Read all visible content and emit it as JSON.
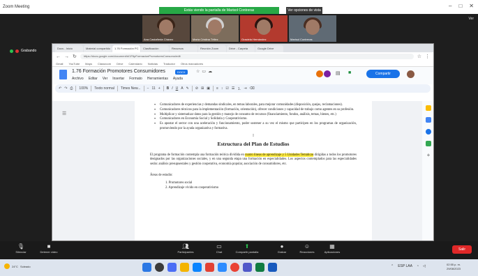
{
  "zoom": {
    "window_title": "Zoom Meeting",
    "share_banner": "Estás viendo la pantalla de Marisol Contreras",
    "view_options": "Ver opciones de vista",
    "view_label": "Ver",
    "participants": [
      {
        "name": "Ana Castañeda Chávez"
      },
      {
        "name": "María Cristina Téllez"
      },
      {
        "name": "Graciela Hernández"
      },
      {
        "name": "Marisol Contreras"
      }
    ],
    "left_indicator": "Grabando"
  },
  "browser": {
    "tabs": [
      "Docs - Inicio",
      "Material compartido",
      "1.76 Formación PC",
      "Clasificación",
      "Recursos",
      "Reunión Zoom",
      "Drive - Carpeta",
      "Google Drive"
    ],
    "url": "https://docs.google.com/document/d/1F6pFormacionPromotoresConsumo/edit",
    "bookmarks": [
      "Gmail",
      "YouTube",
      "Maps",
      "Classroom",
      "Drive",
      "Calendario",
      "Noticias",
      "Traductor",
      "Otros marcadores"
    ]
  },
  "doc": {
    "title": "1.76 Formación Promotores Consumidores",
    "badge": "DOCX",
    "menu": [
      "Archivo",
      "Editar",
      "Ver",
      "Insertar",
      "Formato",
      "Herramientas",
      "Ayuda"
    ],
    "share_label": "Compartir",
    "toolbar": {
      "zoom": "100%",
      "style": "Texto normal",
      "font": "Times New...",
      "size": "11"
    },
    "bullets": [
      "Comunicadores de experiencias y demandas sindicales, en temas laborales, para mejorar comunidades (disposición, quejas, reclamaciones).",
      "Comunicadores técnicos para la implementación (formación, orientación), ofrecer condiciones y capacidad de trabajo como agentes en su profesión.",
      "Multiplicar y sistematizar datos para la gestión y manejo de consumo de recursos (financiamiento, fondos, análisis, temas, bienes, etc.)",
      "Comunicadores en Economía Social y Solidaria y Cooperativismo.",
      "Es apostar el sector con una aceleración y funcionamiento, poder sostener a su vez el mismo que participen en los programas de organización, promoviendo por la ayuda organizativa y formativa."
    ],
    "heading": "Estructura del Plan de Estudios",
    "para_before": "El programa de formación contempla una formación teórica dividida en ",
    "para_highlight": "cuatro líneas de aprendizaje y 5 Unidades Temáticas",
    "para_after": " dirigidas a todos los promotores designados por las organizaciones sociales, y en una segunda etapa una formación en especialidades. Los aspectos contemplados para las especialidades serán: análisis presupuestales y gestión cooperativa, economía popular, asociación de consumidores, etc.",
    "subhead": "Áreas de estudio:",
    "list": [
      "1. Promotores social",
      "2. Aprendizaje vivido en cooperativismo"
    ]
  },
  "controls": {
    "items": [
      "Silenciar",
      "Detener video",
      "Participantes",
      "Chat",
      "Compartir pantalla",
      "Grabar",
      "Reacciones",
      "Aplicaciones"
    ],
    "end": "Salir"
  },
  "taskbar": {
    "weather_temp": "24°C",
    "weather_desc": "Soleado",
    "lang": "ESP LAA",
    "time": "02:55 p. m.",
    "date": "29/08/2023"
  }
}
